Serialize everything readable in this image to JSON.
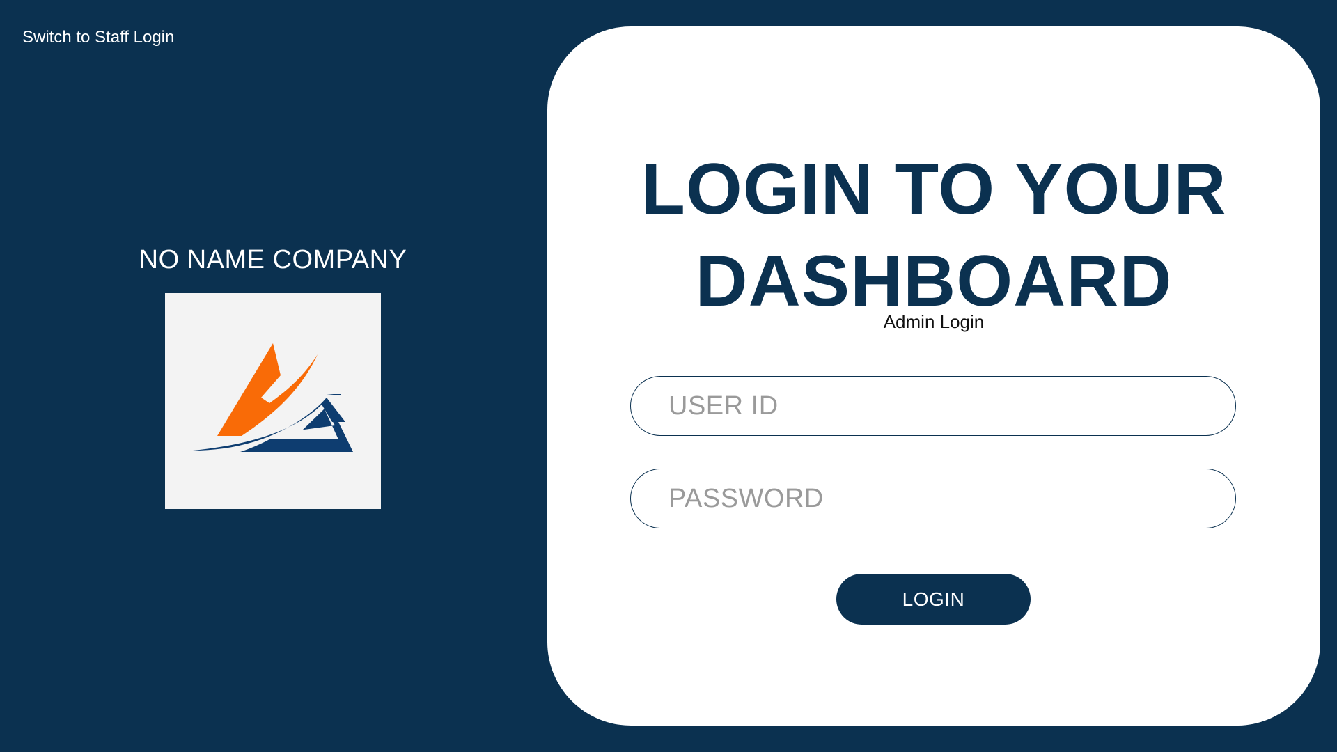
{
  "top_link": {
    "label": "Switch to Staff Login"
  },
  "brand": {
    "company_name": "NO NAME COMPANY",
    "logo_icon": "company-logo-triangle",
    "logo_colors": {
      "orange": "#f96b07",
      "blue": "#0e3d70",
      "background": "#f3f3f3"
    }
  },
  "login_card": {
    "title_line1": "LOGIN TO YOUR",
    "title_line2": "DASHBOARD",
    "subtitle": "Admin Login",
    "user_id": {
      "placeholder": "USER ID",
      "value": ""
    },
    "password": {
      "placeholder": "PASSWORD",
      "value": ""
    },
    "submit_label": "LOGIN"
  },
  "colors": {
    "background": "#0b3150",
    "card": "#ffffff",
    "accent": "#0b3150",
    "placeholder": "#9a9a9a"
  }
}
